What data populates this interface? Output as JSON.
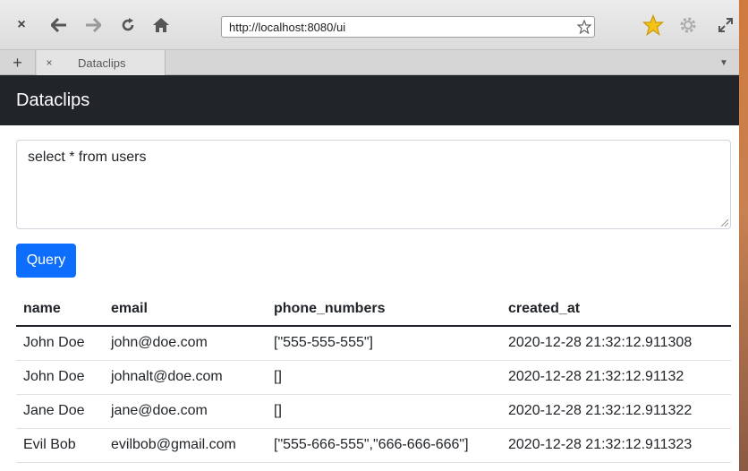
{
  "browser": {
    "url": "http://localhost:8080/ui",
    "tab_title": "Dataclips",
    "new_tab_label": "+",
    "close_label": "×"
  },
  "navbar": {
    "brand": "Dataclips"
  },
  "query": {
    "text": "select * from users",
    "button_label": "Query"
  },
  "table": {
    "headers": [
      "name",
      "email",
      "phone_numbers",
      "created_at"
    ],
    "rows": [
      [
        "John Doe",
        "john@doe.com",
        "[\"555-555-555\"]",
        "2020-12-28 21:32:12.911308"
      ],
      [
        "John Doe",
        "johnalt@doe.com",
        "[]",
        "2020-12-28 21:32:12.91132"
      ],
      [
        "Jane Doe",
        "jane@doe.com",
        "[]",
        "2020-12-28 21:32:12.911322"
      ],
      [
        "Evil Bob",
        "evilbob@gmail.com",
        "[\"555-666-555\",\"666-666-666\"]",
        "2020-12-28 21:32:12.911323"
      ]
    ]
  },
  "colors": {
    "navbar": "#212529",
    "primary": "#0d6efd"
  }
}
